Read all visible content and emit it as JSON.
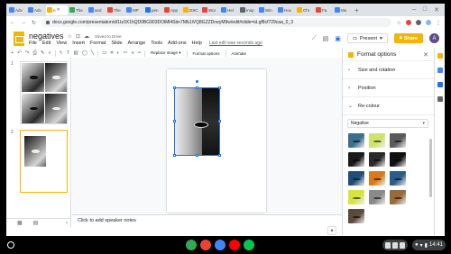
{
  "browser": {
    "tabs": [
      {
        "label": "Adv",
        "color": "#4285f4"
      },
      {
        "label": "Adv",
        "color": "#4285f4"
      },
      {
        "label": "n",
        "color": "#f4b400",
        "active": true
      },
      {
        "label": "The",
        "color": "#34a853"
      },
      {
        "label": "and",
        "color": "#4285f4"
      },
      {
        "label": "The",
        "color": "#ea4335"
      },
      {
        "label": "MP",
        "color": "#4285f4"
      },
      {
        "label": "pen",
        "color": "#1a73e8"
      },
      {
        "label": "App",
        "color": "#ea4335"
      },
      {
        "label": "DSC",
        "color": "#f4b400"
      },
      {
        "label": "Wor",
        "color": "#ea4335"
      },
      {
        "label": "Hel",
        "color": "#4285f4"
      },
      {
        "label": "Insp",
        "color": "#5f6368"
      },
      {
        "label": "Win",
        "color": "#4285f4"
      },
      {
        "label": "Hov",
        "color": "#4285f4"
      },
      {
        "label": "Chr",
        "color": "#f4b400"
      },
      {
        "label": "Fa",
        "color": "#ea4335"
      },
      {
        "label": "Mo",
        "color": "#4285f4"
      }
    ],
    "url": "docs.google.com/presentation/d/1tz3X1hQD0BG903DOlMl4Sbn7Mb1iVQ8GZZDneyM9w/edit#slide=id.gf8cf729caa_0_3",
    "new_tab": "+",
    "minimize": "⌄",
    "window_min": "–",
    "window_max": "□",
    "window_close": "✕"
  },
  "doc": {
    "title": "negatives",
    "saved": "Saved to Drive",
    "menus": [
      "File",
      "Edit",
      "View",
      "Insert",
      "Format",
      "Slide",
      "Arrange",
      "Tools",
      "Add-ons",
      "Help"
    ],
    "last_edit": "Last edit was seconds ago",
    "present": "Present",
    "share": "Share",
    "avatar": "A"
  },
  "toolbar": {
    "replace_image": "Replace image ▾",
    "format_options": "Format options",
    "animate": "Animate"
  },
  "filmstrip": {
    "slides": [
      {
        "num": "1"
      },
      {
        "num": "2"
      }
    ]
  },
  "notes": {
    "placeholder": "Click to add speaker notes"
  },
  "panel": {
    "title": "Format options",
    "sections": [
      "Size and rotation",
      "Position",
      "Re-colour"
    ],
    "recolour_value": "Negative",
    "swatches": [
      "#3a6f8f",
      "#cfe36b",
      "#5a5a5a",
      "#1a1a1a",
      "#2a2a2a",
      "#101010",
      "#1f4e79",
      "#d97a1a",
      "#2a5d8a",
      "#d7e43d",
      "#8a8a8a",
      "#9a6b3a",
      "#5c4a3a"
    ]
  },
  "shelf": {
    "time": "14:41",
    "apps": [
      {
        "name": "chrome-icon",
        "color": "#34a853"
      },
      {
        "name": "gmail-icon",
        "color": "#ea4335"
      },
      {
        "name": "calendar-icon",
        "color": "#4285f4"
      },
      {
        "name": "youtube-icon",
        "color": "#ff0000"
      },
      {
        "name": "play-store-icon",
        "color": "#00c853"
      }
    ]
  }
}
